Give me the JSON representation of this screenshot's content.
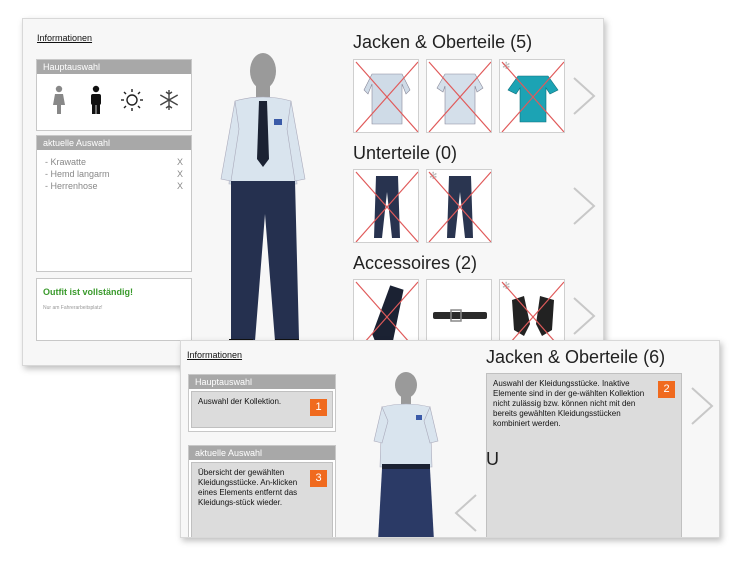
{
  "screen1": {
    "info_link": "Informationen",
    "main_panel": {
      "header": "Hauptauswahl",
      "icons": [
        "female-icon",
        "male-icon",
        "sun-icon",
        "snowflake-icon"
      ]
    },
    "selection_panel": {
      "header": "aktuelle Auswahl",
      "items": [
        {
          "label": "-  Krawatte",
          "remove": "X"
        },
        {
          "label": "-  Hemd langarm",
          "remove": "X"
        },
        {
          "label": "-  Herrenhose",
          "remove": "X"
        }
      ]
    },
    "status_panel": {
      "title": "Outfit ist vollständig!",
      "subtitle": "Nur am Fahrerarbeitsplatz!"
    },
    "sections": {
      "jackets": {
        "title": "Jacken & Oberteile (5)"
      },
      "bottoms": {
        "title": "Unterteile (0)"
      },
      "accessories": {
        "title": "Accessoires (2)"
      }
    }
  },
  "screen2": {
    "info_link": "Informationen",
    "main_panel": {
      "header": "Hauptauswahl",
      "help": "Auswahl der Kollektion.",
      "badge": "1"
    },
    "selection_panel": {
      "header": "aktuelle Auswahl",
      "help": "Übersicht der gewählten Kleidungsstücke. An-klicken eines Elements entfernt das Kleidungs-stück wieder.",
      "badge": "3"
    },
    "jackets": {
      "title": "Jacken & Oberteile (6)",
      "help": "Auswahl der Kleidungsstücke. Inaktive Elemente sind in der ge-wählten Kollektion nicht zulässig bzw. können nicht mit den bereits gewählten Kleidungsstücken kombiniert werden.",
      "badge": "2"
    },
    "bottoms": {
      "title_partial": "U"
    }
  },
  "colors": {
    "header_gray": "#a8a8a8",
    "accent_orange": "#f06a1e",
    "success_green": "#3a9a2c",
    "cross_red": "#e05a5a"
  }
}
